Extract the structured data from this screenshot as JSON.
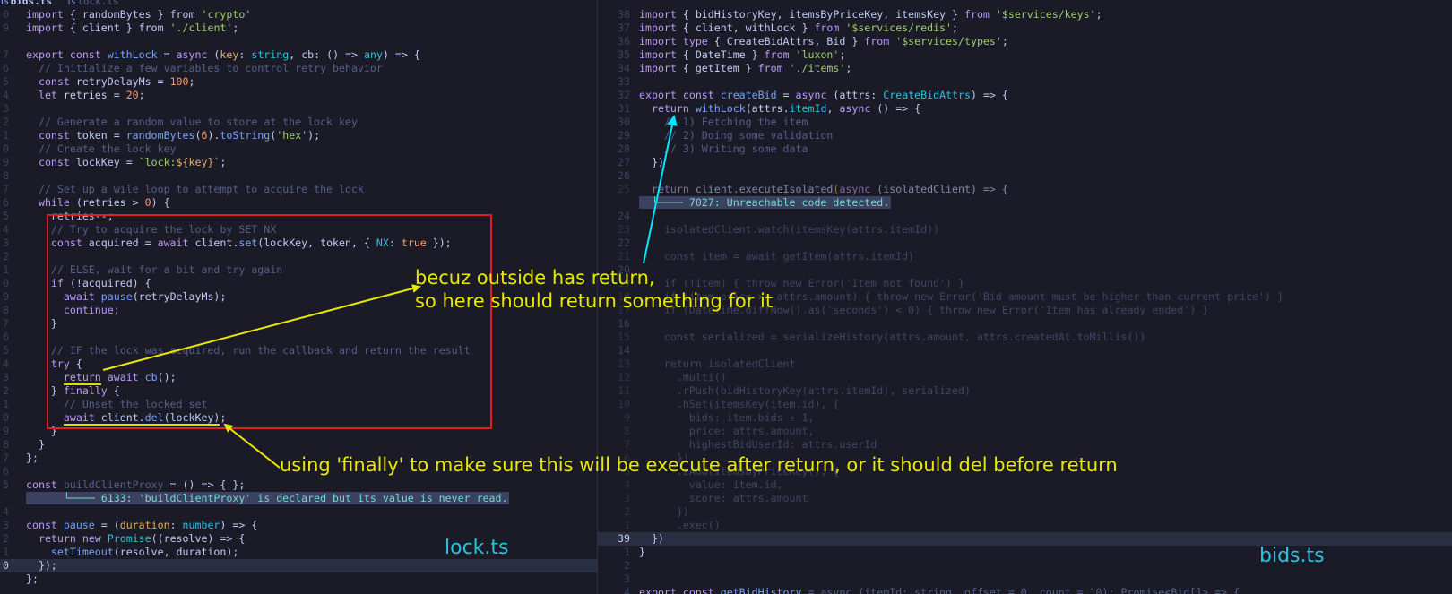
{
  "tabs": {
    "active": "bids.ts",
    "inactive": "lock.ts"
  },
  "left": {
    "gutter": [
      "0",
      "9",
      "",
      "7",
      "6",
      "5",
      "4",
      "3",
      "2",
      "1",
      "0",
      "9",
      "8",
      "7",
      "6",
      "5",
      "4",
      "3",
      "2",
      "1",
      "0",
      "9",
      "8",
      "7",
      "6",
      "5",
      "4",
      "3",
      "2",
      "1",
      "0",
      "9",
      "8",
      "7",
      "6",
      "5",
      "",
      "4",
      "3",
      "2",
      "1",
      "0"
    ],
    "lines": {
      "l0_import": "import",
      "l0_lb": " { ",
      "l0_rb": "randomBytes",
      "l0_from": " } from ",
      "l0_mod": "'crypto'",
      "l1_import": "import",
      "l1_lb": " { ",
      "l1_client": "client",
      "l1_from": " } from ",
      "l1_mod": "'./client'",
      "l1_semi": ";",
      "l3_export": "export const",
      "l3_name": " withLock",
      "l3_eq": " = ",
      "l3_async": "async",
      "l3_params": " (",
      "l3_key": "key",
      "l3_colon": ": ",
      "l3_string": "string",
      "l3_cb": ", cb",
      "l3_rest": ": () => ",
      "l3_any": "any",
      "l3_end": ") => {",
      "l4": "// Initialize a few variables to control retry behavior",
      "l5_const": "const",
      "l5_name": " retryDelayMs = ",
      "l5_val": "100",
      "l5_semi": ";",
      "l6_let": "let",
      "l6_name": " retries = ",
      "l6_val": "20",
      "l6_semi": ";",
      "l8": "// Generate a random value to store at the lock key",
      "l9_const": "const",
      "l9_name": " token = ",
      "l9_fn": "randomBytes",
      "l9_p1": "(",
      "l9_num": "6",
      "l9_p2": ").",
      "l9_fn2": "toString",
      "l9_p3": "(",
      "l9_str": "'hex'",
      "l9_end": ");",
      "l10": "// Create the lock key",
      "l11_const": "const",
      "l11_name": " lockKey = ",
      "l11_tpl1": "`lock:",
      "l11_tplv": "${key}",
      "l11_tpl2": "`",
      "l11_semi": ";",
      "l13": "// Set up a wile loop to attempt to acquire the lock",
      "l14_while": "while",
      "l14_cond": " (retries > ",
      "l14_num": "0",
      "l14_end": ") {",
      "l15": "retries--;",
      "l16": "// Try to acquire the lock by SET NX",
      "l17_const": "const",
      "l17_name": " acquired = ",
      "l17_await": "await",
      "l17_call": " client.",
      "l17_set": "set",
      "l17_args": "(lockKey, token, { ",
      "l17_nx": "NX",
      "l17_colon": ": ",
      "l17_true": "true",
      "l17_end": " });",
      "l19": "// ELSE, wait for a bit and try again",
      "l20_if": "if",
      "l20_cond": " (!acquired) {",
      "l21_await": "await",
      "l21_fn": " pause",
      "l21_args": "(retryDelayMs);",
      "l22": "continue;",
      "l23": "}",
      "l25": "// IF the lock was acquired, run the callback and return the result",
      "l26_try": "try",
      "l26_end": " {",
      "l27_return": "return",
      "l27_await": " await",
      "l27_cb": " cb",
      "l27_end": "();",
      "l28_close": "} ",
      "l28_finally": "finally",
      "l28_end": " {",
      "l29": "// Unset the locked set",
      "l30_await": "await",
      "l30_client": " client.",
      "l30_del": "del",
      "l30_args": "(lockKey)",
      "l30_semi": ";",
      "l31": "}",
      "l32": "}",
      "l33": "};",
      "l35_const": "const",
      "l35_name": " buildClientProxy",
      "l35_rest": " = () => { };",
      "l36_diag": "6133: 'buildClientProxy' is declared but its value is never read.",
      "l38_const": "const",
      "l38_name": " pause",
      "l38_eq": " = (",
      "l38_dur": "duration",
      "l38_colon": ": ",
      "l38_number": "number",
      "l38_end": ") => {",
      "l39_return": "return",
      "l39_new": " new",
      "l39_promise": " Promise",
      "l39_end": "((resolve) => {",
      "l40_fn": "setTimeout",
      "l40_args": "(resolve, duration);",
      "l41": "});",
      "l42": "};"
    }
  },
  "right": {
    "gutter": [
      "38",
      "37",
      "36",
      "35",
      "34",
      "33",
      "32",
      "31",
      "30",
      "29",
      "28",
      "27",
      "26",
      "25",
      "",
      "24",
      "23",
      "22",
      "21",
      "20",
      "19",
      "18",
      "17",
      "16",
      "15",
      "14",
      "13",
      "12",
      "11",
      "10",
      "9",
      "8",
      "7",
      "6",
      "5",
      "4",
      "3",
      "2",
      "1",
      "39",
      "1",
      "2",
      "3",
      "4"
    ],
    "lines": {
      "r0_import": "import",
      "r0_names": " { bidHistoryKey, itemsByPriceKey, itemsKey } ",
      "r0_from": "from",
      "r0_mod": " '$services/keys'",
      "r0_semi": ";",
      "r1_import": "import",
      "r1_names": " { client, withLock } ",
      "r1_from": "from",
      "r1_mod": " '$services/redis'",
      "r1_semi": ";",
      "r2_import": "import type",
      "r2_names": " { CreateBidAttrs, Bid } ",
      "r2_from": "from",
      "r2_mod": " '$services/types'",
      "r2_semi": ";",
      "r3_import": "import",
      "r3_names": " { DateTime } ",
      "r3_from": "from",
      "r3_mod": " 'luxon'",
      "r3_semi": ";",
      "r4_import": "import",
      "r4_names": " { getItem } ",
      "r4_from": "from",
      "r4_mod": " './items'",
      "r4_semi": ";",
      "r6_export": "export const",
      "r6_name": " createBid",
      "r6_eq": " = ",
      "r6_async": "async",
      "r6_params": " (attrs: ",
      "r6_type": "CreateBidAttrs",
      "r6_end": ") => {",
      "r7_return": "return",
      "r7_fn": " withLock",
      "r7_args": "(attrs.",
      "r7_prop": "itemId",
      "r7_comma": ", ",
      "r7_async": "async",
      "r7_end": " () => {",
      "r8": "// 1) Fetching the item",
      "r9": "// 2) Doing some validation",
      "r10": "// 3) Writing some data",
      "r11": "})",
      "r13_return": "return",
      "r13_rest": " client.executeIsolated",
      "r13_paren": "(",
      "r13_async": "async",
      "r13_end": " (isolatedClient) => {",
      "r14_diag": "7027: Unreachable code detected.",
      "r16": "isolatedClient.watch(itemsKey(attrs.itemId))",
      "r18": "const item = await getItem(attrs.itemId)",
      "r20": "if (!item) { throw new Error('Item not found') }",
      "r21": "if (item.price >= attrs.amount) { throw new Error('Bid amount must be higher than current price') }",
      "r22": "if (DateTime.diffNow().as('seconds') < 0) { throw new Error('Item has already ended') }",
      "r24": "const serialized = serializeHistory(attrs.amount, attrs.createdAt.toMillis())",
      "r26": "return isolatedClient",
      "r27": ".multi()",
      "r28": ".rPush(bidHistoryKey(attrs.itemId), serialized)",
      "r29": ".hSet(itemsKey(item.id), {",
      "r30": "bids: item.bids + 1,",
      "r31": "price: attrs.amount,",
      "r32": "highestBidUserId: attrs.userId",
      "r33": "})",
      "r34": ".zAdd(itemsByPriceKey(), {",
      "r35": "value: item.id,",
      "r36": "score: attrs.amount",
      "r37": "})",
      "r38": ".exec()",
      "r39": "})",
      "r40": "}",
      "r43_export": "export const",
      "r43_name": " getBidHistory",
      "r43_rest": " = async (itemId: string, offset = 0, count = 10): Promise<Bid[]> => {"
    }
  },
  "annotations": {
    "return_note_line1": "becuz outside has return,",
    "return_note_line2": "so here should return something for it",
    "finally_note": "using 'finally' to make sure this will be execute after return, or it should del before return",
    "lock_label": "lock.ts",
    "bids_label": "bids.ts"
  },
  "colors": {
    "background": "#1a1b26",
    "annotation": "#e8e800",
    "box": "#e02020",
    "arrow_cyan": "#00e5ff",
    "label": "#2ac3de"
  }
}
